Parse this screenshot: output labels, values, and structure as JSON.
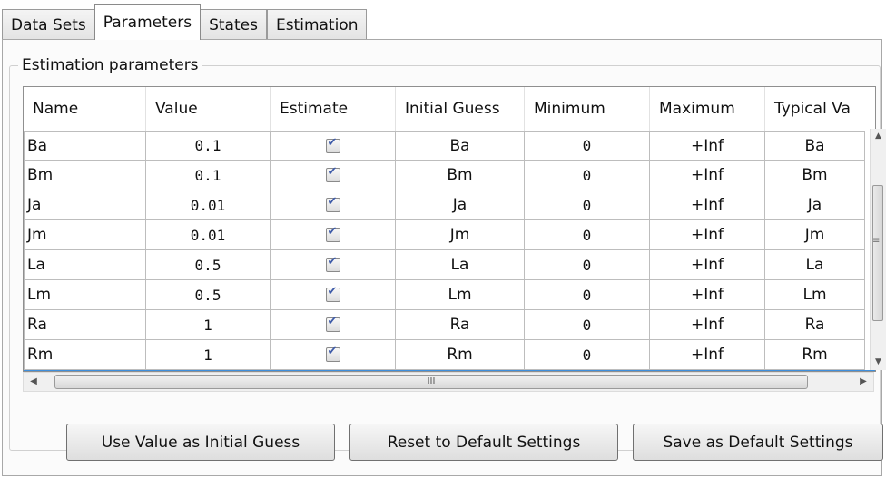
{
  "tabs": [
    {
      "label": "Data Sets",
      "active": false
    },
    {
      "label": "Parameters",
      "active": true
    },
    {
      "label": "States",
      "active": false
    },
    {
      "label": "Estimation",
      "active": false
    }
  ],
  "group_title": "Estimation parameters",
  "table": {
    "columns": [
      "Name",
      "Value",
      "Estimate",
      "Initial Guess",
      "Minimum",
      "Maximum",
      "Typical Va"
    ],
    "rows": [
      {
        "name": "Ba",
        "value": "0.1",
        "estimate": true,
        "initial_guess": "Ba",
        "minimum": "0",
        "maximum": "+Inf",
        "typical": "Ba"
      },
      {
        "name": "Bm",
        "value": "0.1",
        "estimate": true,
        "initial_guess": "Bm",
        "minimum": "0",
        "maximum": "+Inf",
        "typical": "Bm"
      },
      {
        "name": "Ja",
        "value": "0.01",
        "estimate": true,
        "initial_guess": "Ja",
        "minimum": "0",
        "maximum": "+Inf",
        "typical": "Ja"
      },
      {
        "name": "Jm",
        "value": "0.01",
        "estimate": true,
        "initial_guess": "Jm",
        "minimum": "0",
        "maximum": "+Inf",
        "typical": "Jm"
      },
      {
        "name": "La",
        "value": "0.5",
        "estimate": true,
        "initial_guess": "La",
        "minimum": "0",
        "maximum": "+Inf",
        "typical": "La"
      },
      {
        "name": "Lm",
        "value": "0.5",
        "estimate": true,
        "initial_guess": "Lm",
        "minimum": "0",
        "maximum": "+Inf",
        "typical": "Lm"
      },
      {
        "name": "Ra",
        "value": "1",
        "estimate": true,
        "initial_guess": "Ra",
        "minimum": "0",
        "maximum": "+Inf",
        "typical": "Ra"
      },
      {
        "name": "Rm",
        "value": "1",
        "estimate": true,
        "initial_guess": "Rm",
        "minimum": "0",
        "maximum": "+Inf",
        "typical": "Rm"
      }
    ]
  },
  "scrollbars": {
    "up_arrow": "▲",
    "down_arrow": "▼",
    "grip": "≡",
    "left_arrow": "◀",
    "right_arrow": "▶",
    "h_grip": "III"
  },
  "buttons": {
    "use_value": "Use Value as Initial Guess",
    "reset": "Reset to Default Settings",
    "save": "Save as Default Settings"
  },
  "colors": {
    "selection_line": "#3f8fdc",
    "check": "#3d5aa8"
  }
}
